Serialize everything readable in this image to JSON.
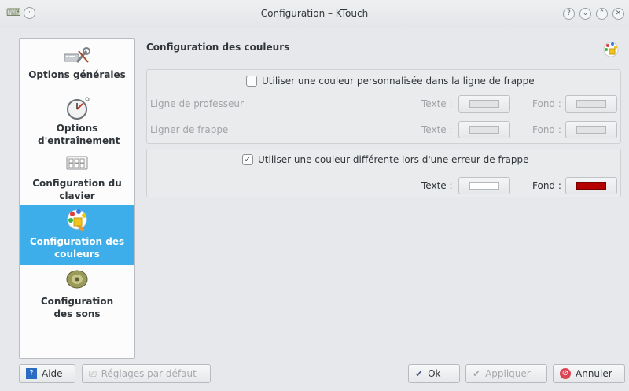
{
  "window": {
    "title": "Configuration – KTouch",
    "controls": [
      "?",
      "⌄",
      "⌃",
      "✕"
    ]
  },
  "sidebar": {
    "items": [
      {
        "label": "Options générales",
        "icon": "tools-icon"
      },
      {
        "label": "Options d'entraînement",
        "icon": "stopwatch-icon"
      },
      {
        "label": "Configuration du clavier",
        "icon": "keyboard-icon"
      },
      {
        "label": "Configuration des couleurs",
        "icon": "color-palette-icon",
        "active": true
      },
      {
        "label": "Configuration des sons",
        "icon": "speaker-icon"
      }
    ]
  },
  "main": {
    "title": "Configuration des couleurs",
    "group1": {
      "checkbox_label": "Utiliser une couleur personnalisée dans la ligne de frappe",
      "checked": false,
      "rows": [
        {
          "label": "Ligne de professeur",
          "texte": "Texte :",
          "fond": "Fond :"
        },
        {
          "label": "Ligner de frappe",
          "texte": "Texte :",
          "fond": "Fond :"
        }
      ]
    },
    "group2": {
      "checkbox_label": "Utiliser une couleur différente lors d'une erreur de frappe",
      "checked": true,
      "texte": "Texte :",
      "fond": "Fond :",
      "texte_color": "#ffffff",
      "fond_color": "#b40000"
    }
  },
  "buttons": {
    "help": "Aide",
    "defaults": "Réglages par défaut",
    "ok": "Ok",
    "apply": "Appliquer",
    "cancel": "Annuler"
  },
  "colors": {
    "accent": "#3daee9",
    "error_red": "#b40000"
  }
}
